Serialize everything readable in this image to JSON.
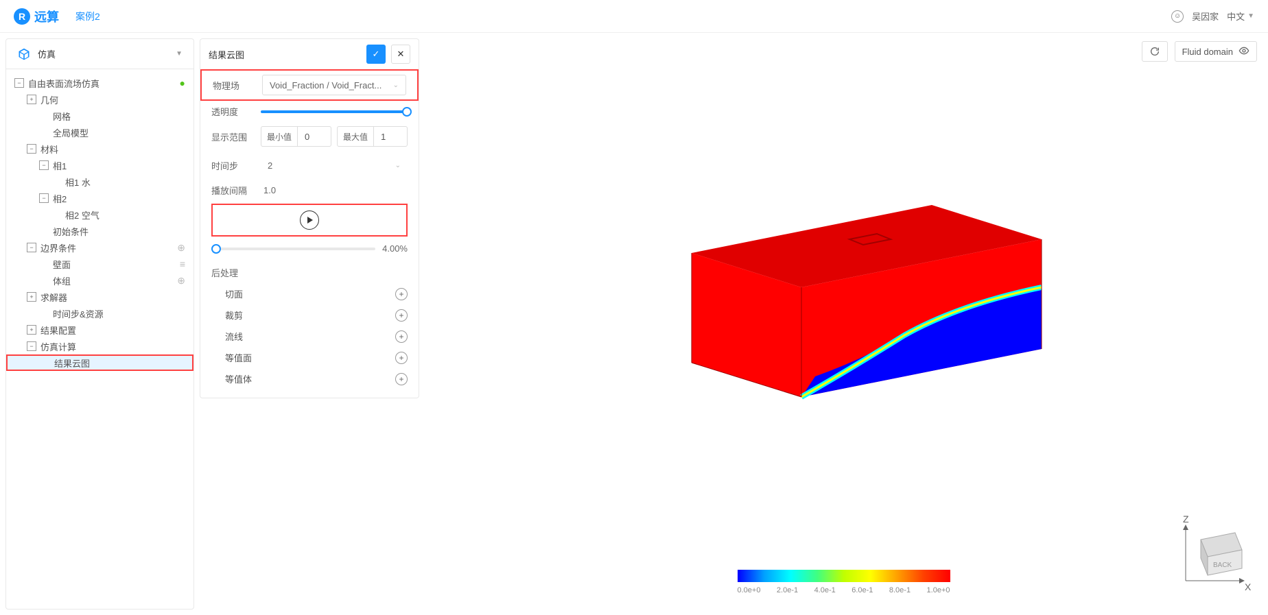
{
  "header": {
    "logo_text": "远算",
    "case_name": "案例2",
    "user_name": "吴因家",
    "language": "中文"
  },
  "sidebar": {
    "title": "仿真",
    "tree": [
      {
        "level": 0,
        "icon": "−",
        "label": "自由表面流场仿真",
        "right": "ok"
      },
      {
        "level": 1,
        "icon": "+",
        "label": "几何"
      },
      {
        "level": 2,
        "icon": "",
        "label": "网格"
      },
      {
        "level": 2,
        "icon": "",
        "label": "全局模型"
      },
      {
        "level": 1,
        "icon": "−",
        "label": "材料"
      },
      {
        "level": 2,
        "icon": "−",
        "label": "相1"
      },
      {
        "level": 3,
        "icon": "",
        "label": "相1 水"
      },
      {
        "level": 2,
        "icon": "−",
        "label": "相2"
      },
      {
        "level": 3,
        "icon": "",
        "label": "相2 空气"
      },
      {
        "level": 2,
        "icon": "",
        "label": "初始条件"
      },
      {
        "level": 1,
        "icon": "−",
        "label": "边界条件",
        "right": "add"
      },
      {
        "level": 2,
        "icon": "",
        "label": "壁面",
        "right": "menu"
      },
      {
        "level": 2,
        "icon": "",
        "label": "体组",
        "right": "add"
      },
      {
        "level": 1,
        "icon": "+",
        "label": "求解器"
      },
      {
        "level": 2,
        "icon": "",
        "label": "时间步&资源"
      },
      {
        "level": 1,
        "icon": "+",
        "label": "结果配置"
      },
      {
        "level": 1,
        "icon": "−",
        "label": "仿真计算"
      },
      {
        "level": 2,
        "icon": "",
        "label": "结果云图",
        "selected": true,
        "highlight": true
      }
    ]
  },
  "panel": {
    "title": "结果云图",
    "field_label": "物理场",
    "field_value": "Void_Fraction / Void_Fract...",
    "opacity_label": "透明度",
    "range_label": "显示范围",
    "range_min_label": "最小值",
    "range_min": "0",
    "range_max_label": "最大值",
    "range_max": "1",
    "timestep_label": "时间步",
    "timestep_value": "2",
    "interval_label": "播放间隔",
    "interval_value": "1.0",
    "progress_pct": "4.00%",
    "post_title": "后处理",
    "post_items": [
      "切面",
      "裁剪",
      "流线",
      "等值面",
      "等值体"
    ]
  },
  "viewport": {
    "refresh_title": "",
    "domain_label": "Fluid domain",
    "colormap_ticks": [
      "0.0e+0",
      "2.0e-1",
      "4.0e-1",
      "6.0e-1",
      "8.0e-1",
      "1.0e+0"
    ],
    "axes": {
      "z": "Z",
      "x": "X",
      "cube": "BACK"
    }
  }
}
